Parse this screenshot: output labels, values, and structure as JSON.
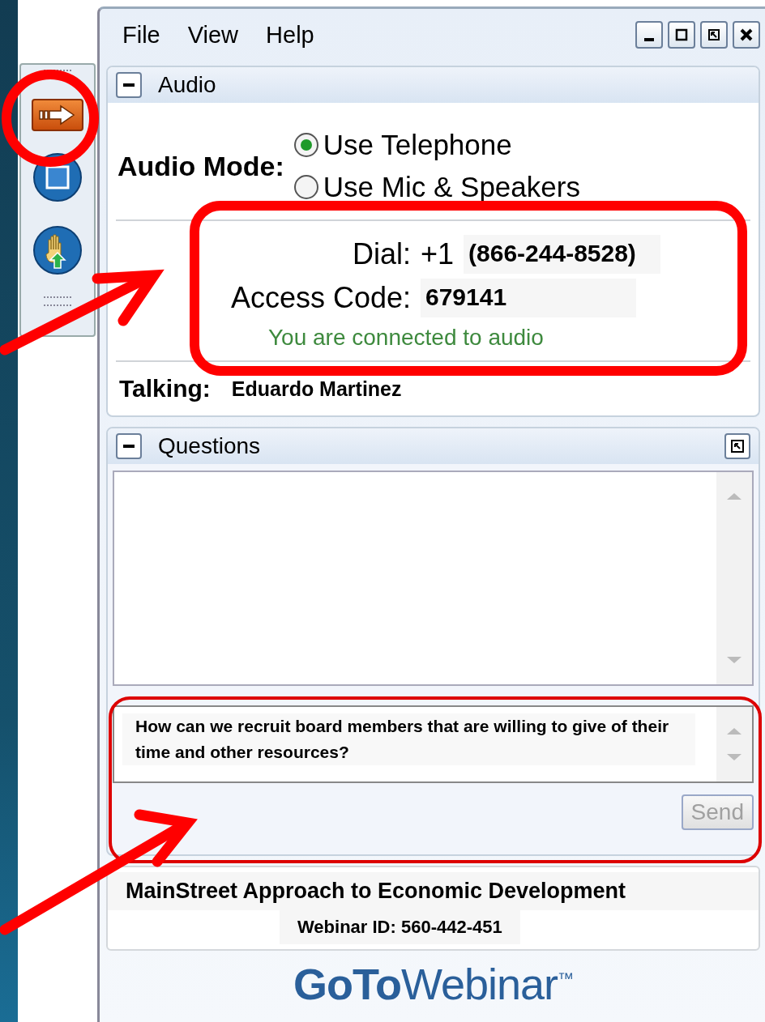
{
  "menu": [
    {
      "label": "File"
    },
    {
      "label": "View"
    },
    {
      "label": "Help"
    }
  ],
  "audio": {
    "title": "Audio",
    "expanded": true,
    "mode_label": "Audio Mode:",
    "options": [
      {
        "label": "Use Telephone",
        "selected": true
      },
      {
        "label": "Use Mic & Speakers",
        "selected": false
      }
    ],
    "dial_label": "Dial:",
    "dial_prefix": "+1",
    "dial_number": "(866-244-8528)",
    "code_label": "Access Code:",
    "code": "679141",
    "status": "You are connected to audio",
    "talking_label": "Talking:",
    "talking": "Eduardo Martinez"
  },
  "questions": {
    "title": "Questions",
    "expanded": true,
    "draft": "How can we recruit board members that are willing to give of their time and other resources?",
    "send": {
      "label": "Send",
      "disabled": true
    }
  },
  "footer": {
    "title": "MainStreet Approach to Economic Development",
    "webinar_id": "Webinar ID: 560-442-451"
  },
  "logo": "**GoTo**Webinar$^{™}$"
}
